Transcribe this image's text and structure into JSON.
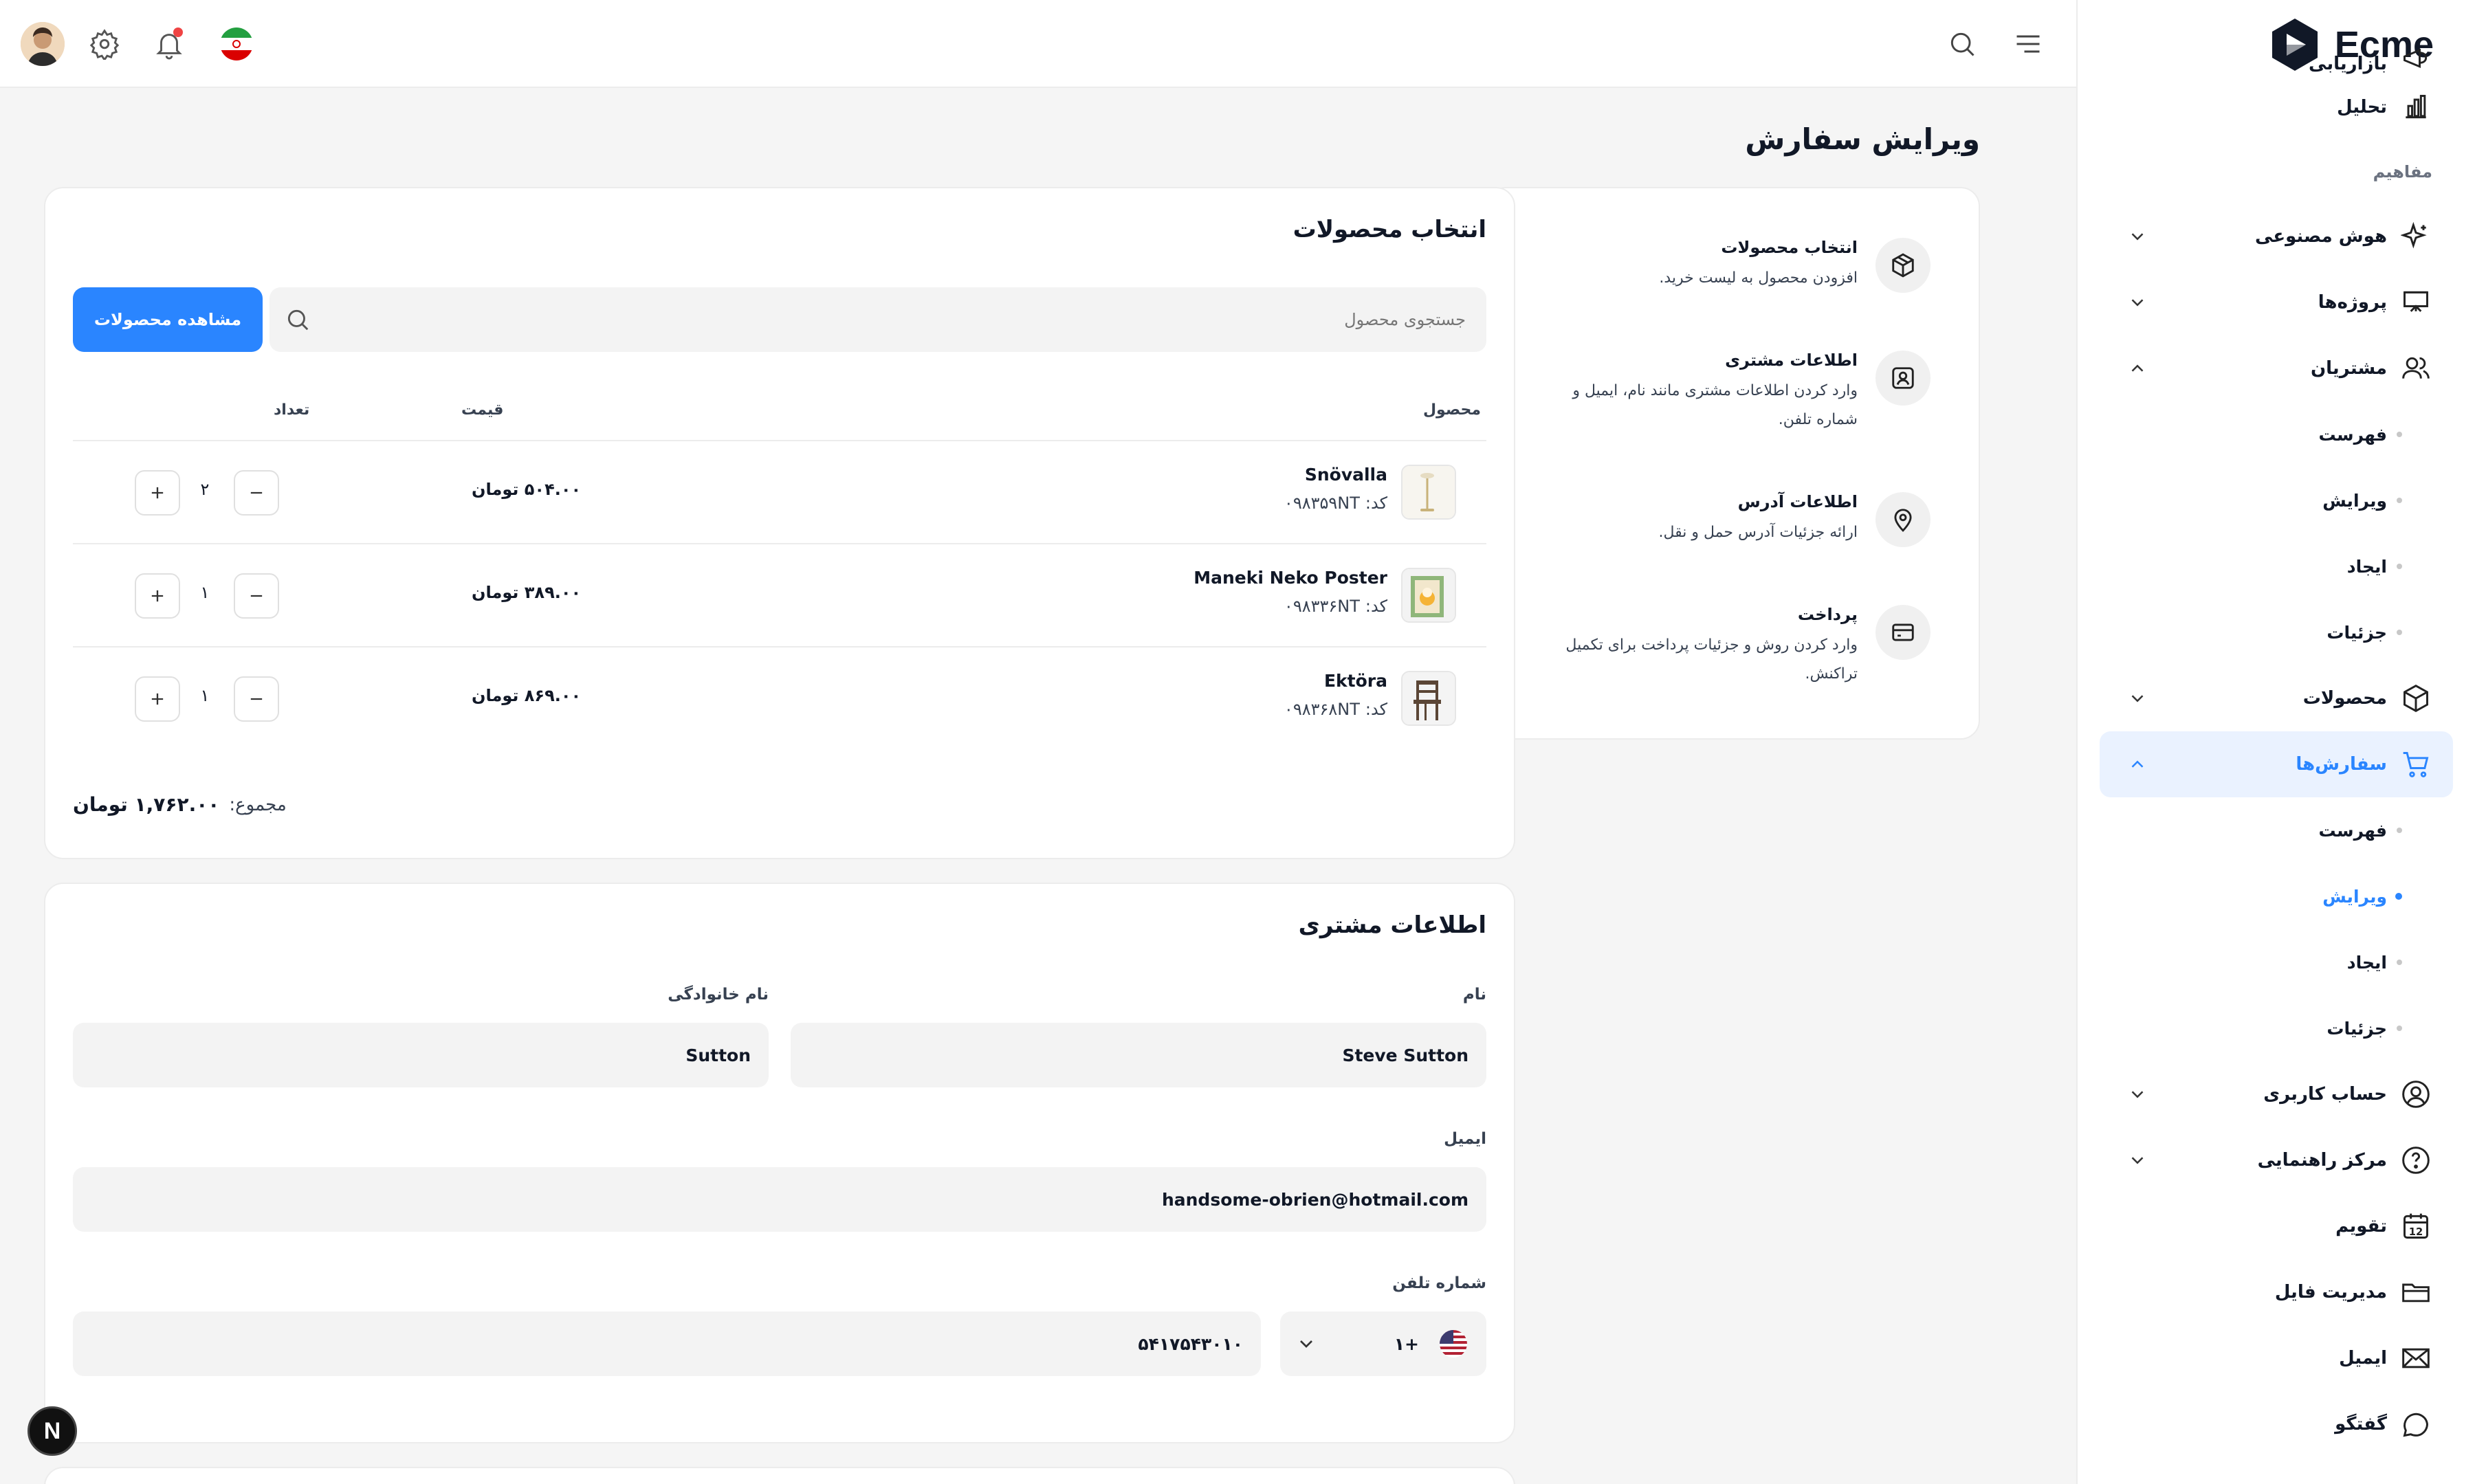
{
  "app": {
    "name": "Ecme",
    "page_title": "ویرایش سفارش"
  },
  "topbar": {
    "search_icon": "search-icon",
    "menu_icon": "hamburger-icon"
  },
  "sidebar": {
    "items": [
      {
        "label": "بازاریابی",
        "icon": "megaphone-icon"
      },
      {
        "label": "تحلیل",
        "icon": "bar-chart-icon"
      },
      {
        "section": "مفاهیم"
      },
      {
        "label": "هوش مصنوعی",
        "icon": "sparkle-icon",
        "expandable": true
      },
      {
        "label": "پروژه‌ها",
        "icon": "presentation-icon",
        "expandable": true
      },
      {
        "label": "مشتریان",
        "icon": "users-icon",
        "expanded": true,
        "children": [
          "فهرست",
          "ویرایش",
          "ایجاد",
          "جزئیات"
        ]
      },
      {
        "label": "محصولات",
        "icon": "box-icon",
        "expandable": true
      },
      {
        "label": "سفارش‌ها",
        "icon": "cart-icon",
        "active": true,
        "children": [
          "فهرست",
          "ویرایش",
          "ایجاد",
          "جزئیات"
        ],
        "active_child": 1
      },
      {
        "label": "حساب کاربری",
        "icon": "user-circle-icon",
        "expandable": true
      },
      {
        "label": "مرکز راهنمایی",
        "icon": "help-circle-icon",
        "expandable": true
      },
      {
        "label": "تقویم",
        "icon": "calendar-icon"
      },
      {
        "label": "مدیریت فایل",
        "icon": "folder-icon"
      },
      {
        "label": "ایمیل",
        "icon": "mail-icon"
      },
      {
        "label": "گفتگو",
        "icon": "chat-icon"
      }
    ],
    "calendar_day": "12"
  },
  "steps": [
    {
      "title": "انتخاب محصولات",
      "desc": [
        "افزودن محصول به لیست خرید."
      ],
      "icon": "package-icon"
    },
    {
      "title": "اطلاعات مشتری",
      "desc": [
        "وارد کردن اطلاعات مشتری مانند نام، ایمیل و",
        "شماره تلفن."
      ],
      "icon": "user-card-icon"
    },
    {
      "title": "اطلاعات آدرس",
      "desc": [
        "ارائه جزئیات آدرس حمل و نقل."
      ],
      "icon": "location-pin-icon"
    },
    {
      "title": "پرداخت",
      "desc": [
        "وارد کردن روش و جزئیات پرداخت برای تکمیل",
        "تراکنش."
      ],
      "icon": "credit-card-icon"
    }
  ],
  "products": {
    "title": "انتخاب محصولات",
    "search_placeholder": "جستجوی محصول",
    "view_button": "مشاهده محصولات",
    "columns": {
      "product": "محصول",
      "price": "قیمت",
      "quantity": "تعداد"
    },
    "code_label": "کد:",
    "rows": [
      {
        "name": "Snövalla",
        "code": "۰۹۸۳۵۹NT",
        "price": "۵۰۴.۰۰ تومان",
        "qty": "۲"
      },
      {
        "name": "Maneki Neko Poster",
        "code": "۰۹۸۳۳۶NT",
        "price": "۳۸۹.۰۰ تومان",
        "qty": "۱"
      },
      {
        "name": "Ektöra",
        "code": "۰۹۸۳۶۸NT",
        "price": "۸۶۹.۰۰ تومان",
        "qty": "۱"
      }
    ],
    "total_label": "مجموع:",
    "total_value": "۱,۷۶۲.۰۰ تومان"
  },
  "customer": {
    "title": "اطلاعات مشتری",
    "first_name_label": "نام",
    "first_name": "Steve Sutton",
    "last_name_label": "نام خانوادگی",
    "last_name": "Sutton",
    "email_label": "ایمیل",
    "email": "handsome-obrien@hotmail.com",
    "phone_label": "شماره تلفن",
    "dial_code": "+۱",
    "phone": "۵۴۱۷۵۴۳۰۱۰"
  },
  "fab_letter": "N",
  "colors": {
    "accent": "#2a85ff",
    "active_bg": "#eaf2ff",
    "page_bg": "#f5f5f5"
  }
}
